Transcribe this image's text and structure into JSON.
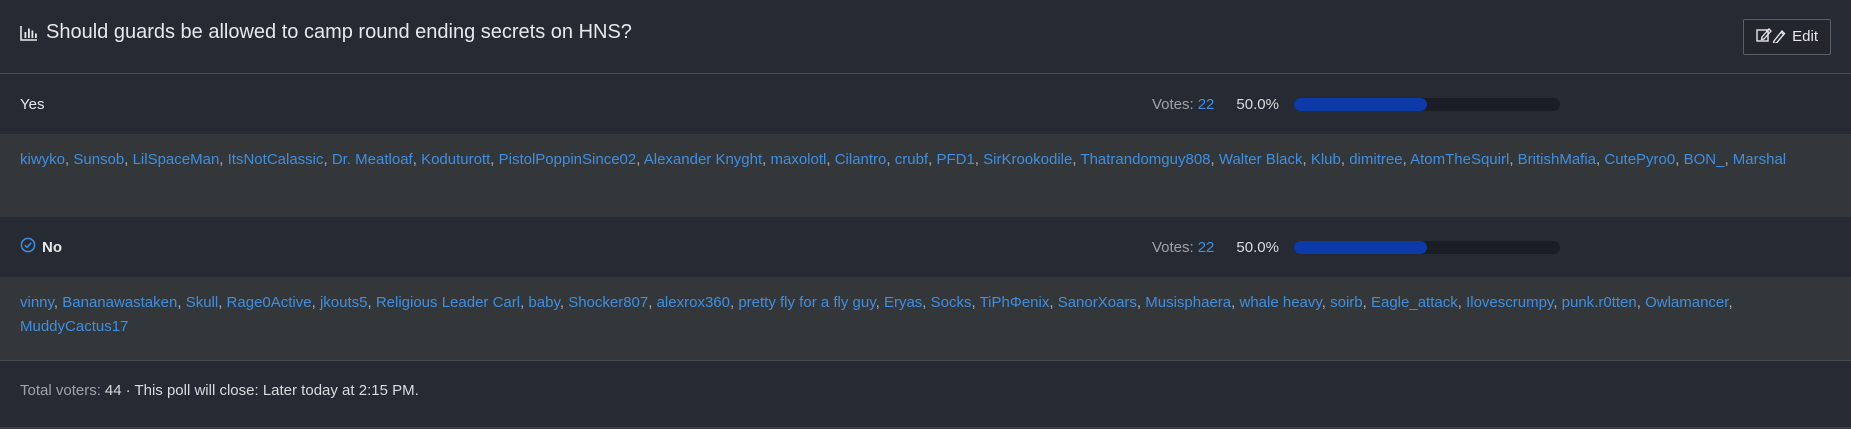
{
  "poll": {
    "title": "Should guards be allowed to camp round ending secrets on HNS?",
    "edit_label": "Edit",
    "options": [
      {
        "label": "Yes",
        "selected": false,
        "votes_label": "Votes:",
        "votes": "22",
        "percent_text": "50.0%",
        "percent": 50.0,
        "voters": [
          "kiwyko",
          "Sunsob",
          "LilSpaceMan",
          "ItsNotCalassic",
          "Dr. Meatloaf",
          "Koduturott",
          "PistolPoppinSince02",
          "Alexander Knyght",
          "maxolotl",
          "Cilantro",
          "crubf",
          "PFD1",
          "SirKrookodile",
          "Thatrandomguy808",
          "Walter Black",
          "Klub",
          "dimitree",
          "AtomTheSquirl",
          "BritishMafia",
          "CutePyro0",
          "BON_",
          "Marshal"
        ]
      },
      {
        "label": "No",
        "selected": true,
        "votes_label": "Votes:",
        "votes": "22",
        "percent_text": "50.0%",
        "percent": 50.0,
        "voters": [
          "vinny",
          "Bananawastaken",
          "Skull",
          "Rage0Active",
          "jkouts5",
          "Religious Leader Carl",
          "baby",
          "Shocker807",
          "alexrox360",
          "pretty fly for a fly guy",
          "Eryas",
          "Socks",
          "TiPhΦenix",
          "SanorXoars",
          "Musisphaera",
          "whale heavy",
          "soirb",
          "Eagle_attack",
          "Ilovescrumpy",
          "punk.r0tten",
          "Owlamancer",
          "MuddyCactus17"
        ]
      }
    ],
    "footer": {
      "total_label": "Total voters:",
      "total": "44",
      "close_text": "· This poll will close: Later today at 2:15 PM."
    },
    "colors": {
      "accent_link": "#3f8ee0",
      "bar_fill": "#0c3aa8",
      "background": "#262a32",
      "voters_background": "#343739"
    },
    "icons": {
      "title": "bar-chart-icon",
      "edit": "edit-icon",
      "selected": "check-circle-icon"
    }
  }
}
